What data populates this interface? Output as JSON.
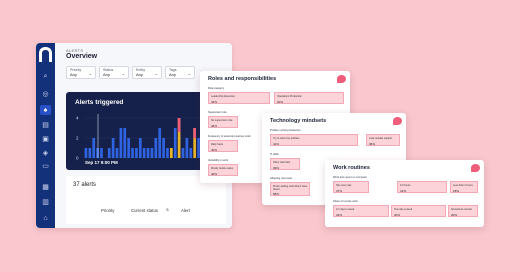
{
  "app": {
    "section": "ALERTS",
    "title": "Overview"
  },
  "filters": [
    {
      "label": "Priority",
      "value": "Any"
    },
    {
      "label": "Status",
      "value": "Any"
    },
    {
      "label": "Entity",
      "value": "Any"
    },
    {
      "label": "Tags",
      "value": "Any"
    }
  ],
  "chart": {
    "title": "Alerts triggered",
    "date_label": "Sep 17 9:00 PM"
  },
  "chart_data": {
    "type": "bar",
    "ylim": [
      0,
      4
    ],
    "ticks": [
      4,
      2,
      0
    ],
    "values": [
      1,
      1,
      2,
      1,
      1,
      0,
      1,
      2,
      1,
      3,
      3,
      2,
      1,
      1,
      2,
      1,
      1,
      1,
      2,
      3,
      2,
      1,
      1,
      3,
      4,
      1,
      2,
      1,
      3,
      2,
      1,
      3,
      4,
      2
    ],
    "highlight": [
      0,
      0,
      0,
      0,
      0,
      0,
      0,
      0,
      0,
      0,
      0,
      0,
      0,
      0,
      0,
      0,
      0,
      0,
      0,
      0,
      0,
      0,
      1,
      0,
      1,
      0,
      0,
      0,
      1,
      0,
      0,
      1,
      1,
      0
    ],
    "colors": {
      "bar": "#2f63e0",
      "highlight": "#e9b52a",
      "hot": "#ef5d7a"
    }
  },
  "alerts": {
    "count": "37 alerts",
    "columns": [
      "Priority",
      "Current status",
      "Alert"
    ]
  },
  "cards": [
    {
      "title": "Roles and responsibilities",
      "sections": [
        {
          "label": "Role category",
          "cells": [
            {
              "label": "Leadership Executive",
              "value": "34%"
            },
            {
              "label": "Operations Production",
              "value": "30%"
            }
          ]
        },
        {
          "label": "Supervision role",
          "cells": [
            {
              "label": "No supervision role",
              "value": "46%"
            }
          ]
        },
        {
          "label": "Frequency of external customer work",
          "cells": [
            {
              "label": "Daily basis",
              "value": "40%"
            }
          ]
        },
        {
          "label": "Variability in work",
          "cells": [
            {
              "label": "Mostly routine tasks",
              "value": "40%"
            }
          ]
        }
      ]
    },
    {
      "title": "Technology mindsets",
      "sections": [
        {
          "label": "Problem solving behaviour",
          "cells": [
            {
              "label": "Try to solve the problem",
              "value": "41%"
            },
            {
              "label": "Look outside support",
              "value": "36%"
            }
          ]
        },
        {
          "label": "IT skills",
          "cells": [
            {
              "label": "Often rated fast",
              "value": "39%"
            }
          ]
        },
        {
          "label": "Adopting new tools",
          "cells": [
            {
              "label": "Prefer waiting until others have tried it",
              "value": "58%"
            }
          ]
        }
      ]
    },
    {
      "title": "Work routines",
      "sections": [
        {
          "label": "Work time spent on computer",
          "cells": [
            {
              "label": "Not every day",
              "value": "37%"
            },
            {
              "label": "4-6 hours",
              "value": "31%"
            },
            {
              "label": "Less than 2 hours",
              "value": "18%"
            }
          ]
        },
        {
          "label": "Share of remote work",
          "cells": [
            {
              "label": "0-1 days a week",
              "value": "34%"
            },
            {
              "label": "One day a week",
              "value": "30%"
            },
            {
              "label": "Sometimes remote",
              "value": "20%"
            }
          ]
        }
      ]
    }
  ]
}
